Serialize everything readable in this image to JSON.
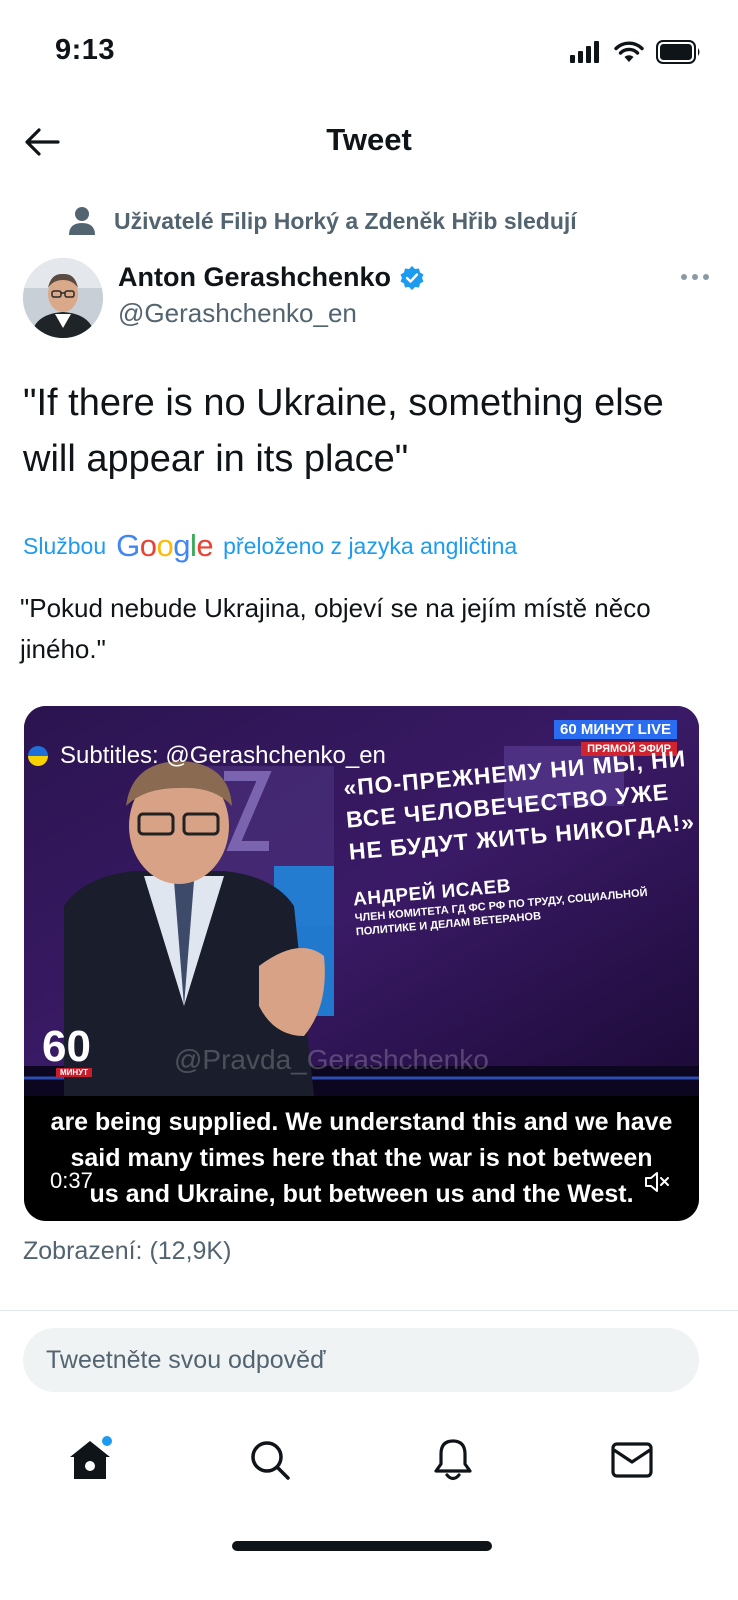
{
  "status_bar": {
    "time": "9:13"
  },
  "header": {
    "title": "Tweet"
  },
  "social_context": {
    "text": "Uživatelé Filip Horký a Zdeněk Hřib sledují"
  },
  "author": {
    "name": "Anton Gerashchenko",
    "handle": "@Gerashchenko_en",
    "verified": true
  },
  "tweet": {
    "text": "\"If there is no Ukraine, something else will appear in its place\"",
    "translated_prefix": "Službou",
    "translated_logo": "Google",
    "translated_suffix": "přeloženo z jazyka angličtina",
    "translated_text": "\"Pokud nebude Ukrajina, objeví se na jejím místě něco jiného.\""
  },
  "video": {
    "watermark_subtitles": "Subtitles: @Gerashchenko_en",
    "live_badge_line1": "60 МИНУТ LIVE",
    "live_badge_line2": "ПРЯМОЙ ЭФИР",
    "quote": "«ПО-ПРЕЖНЕМУ НИ МЫ, НИ ВСЕ ЧЕЛОВЕЧЕСТВО УЖЕ НЕ БУДУТ ЖИТЬ НИКОГДА!»",
    "speaker_name": "АНДРЕЙ ИСАЕВ",
    "speaker_role": "ЧЛЕН КОМИТЕТА ГД ФС РФ ПО ТРУДУ, СОЦИАЛЬНОЙ ПОЛИТИКЕ И ДЕЛАМ ВЕТЕРАНОВ",
    "channel_logo": "60",
    "channel_logo_sub": "МИНУТ",
    "watermark_pravda": "@Pravda_Gerashchenko",
    "subtitle_lines": [
      "are being supplied. We understand this and we have",
      "said many times here that the war is not between",
      "us and Ukraine, but between us and the West."
    ],
    "time": "0:37",
    "muted": true
  },
  "views": {
    "label": "Zobrazení: (12,9K)"
  },
  "reply": {
    "placeholder": "Tweetněte svou odpověď"
  },
  "tab_bar": {
    "tabs": [
      "home",
      "search",
      "notifications",
      "messages"
    ],
    "active": "home",
    "accent": "#1d9bf0"
  },
  "colors": {
    "accent": "#1d9bf0",
    "text": "#0f1419",
    "secondary": "#536471"
  }
}
